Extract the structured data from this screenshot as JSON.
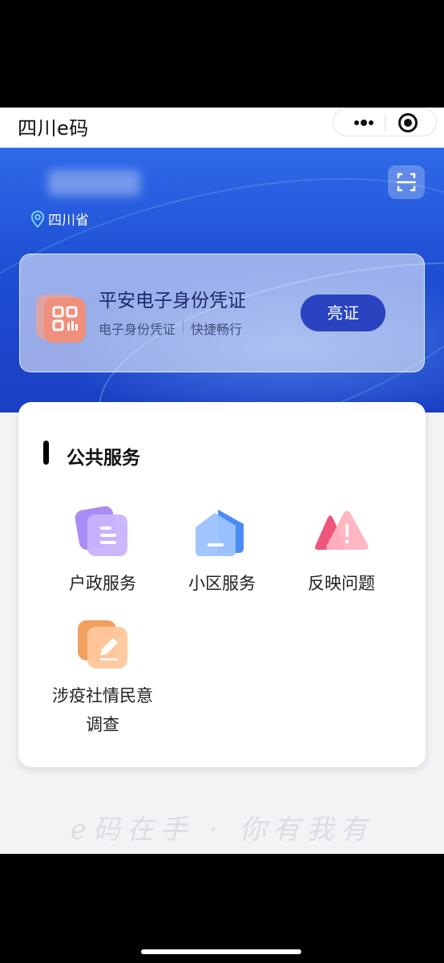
{
  "navbar": {
    "title": "四川e码"
  },
  "hero": {
    "location": "四川省",
    "id_card": {
      "title": "平安电子身份凭证",
      "subtitle_left": "电子身份凭证",
      "subtitle_right": "快捷畅行",
      "button": "亮证"
    }
  },
  "services": {
    "title": "公共服务",
    "items": [
      {
        "label": "户政服务",
        "icon": "household-registration-icon"
      },
      {
        "label": "小区服务",
        "icon": "community-icon"
      },
      {
        "label": "反映问题",
        "icon": "report-issue-icon"
      },
      {
        "label_line1": "涉疫社情民意",
        "label_line2": "调查",
        "icon": "survey-edit-icon"
      }
    ]
  },
  "footer": {
    "slogan": "e码在手 · 你有我有"
  },
  "colors": {
    "brand_blue": "#1f4fd4",
    "button_blue": "#2a43c0"
  }
}
